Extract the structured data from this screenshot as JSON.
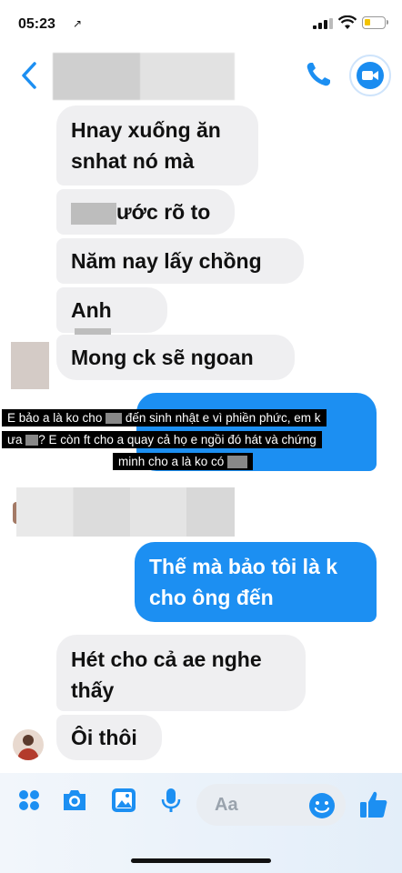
{
  "status_bar": {
    "time": "05:23",
    "location_glyph": "↗"
  },
  "header": {},
  "messages": [
    {
      "text": "Hnay xuống ăn snhat nó mà",
      "line1": "Hnay xuống ăn",
      "line2": "snhat nó mà",
      "side": "in"
    },
    {
      "text": "ước rõ to",
      "side": "in"
    },
    {
      "text": "Năm nay lấy chồng",
      "side": "in"
    },
    {
      "text": "Anh",
      "side": "in"
    },
    {
      "text": "Mong ck sẽ ngoan",
      "side": "in"
    },
    {
      "text": "Thế mà bảo tôi là k cho ông đến",
      "line1": "Thế mà bảo tôi là k",
      "line2": "cho ông đến",
      "side": "out"
    },
    {
      "text": "Hét cho cả ae nghe thấy",
      "line1": "Hét cho cả ae nghe",
      "line2": "thấy",
      "side": "in"
    },
    {
      "text": "Ôi thôi",
      "side": "in"
    }
  ],
  "caption": {
    "line1a": "E bảo a là ko cho ",
    "line1b": " đến sinh nhật e vì phiền phức, em k",
    "line2a": "ưa ",
    "line2b": "? E còn ft cho a quay cả họ e ngồi đó hát và chứng",
    "line3a": "minh cho a là ko có ",
    "line3b": ""
  },
  "composer": {
    "placeholder": "Aa"
  },
  "colors": {
    "accent": "#1c8ff2",
    "incoming_bubble": "#efeff1"
  }
}
